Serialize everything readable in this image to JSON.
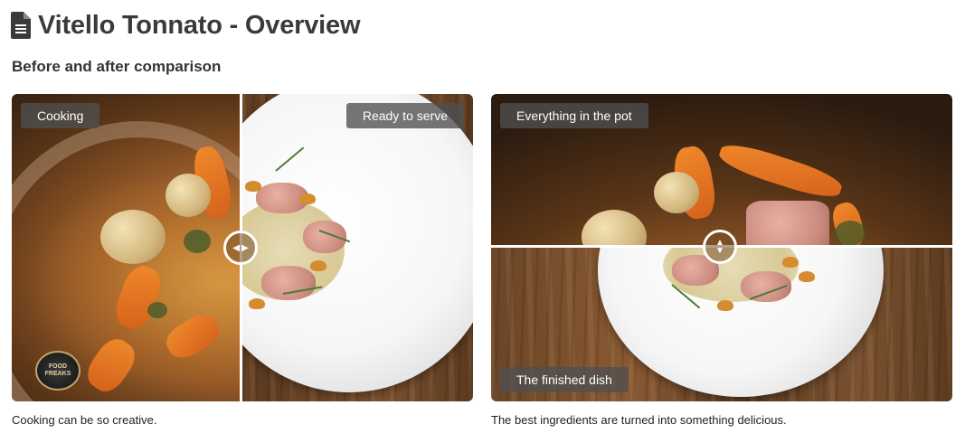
{
  "page": {
    "title": "Vitello Tonnato - Overview",
    "subtitle": "Before and after comparison",
    "title_icon": "document-icon"
  },
  "comparisons": [
    {
      "orientation": "vertical-split",
      "before_label": "Cooking",
      "after_label": "Ready to serve",
      "caption": "Cooking can be so creative.",
      "slider_position_percent": 49,
      "logo_text": "FOOD FREAKS"
    },
    {
      "orientation": "horizontal-split",
      "before_label": "Everything in the pot",
      "after_label": "The finished dish",
      "caption": "The best ingredients are turned into something delicious.",
      "slider_position_percent": 49
    }
  ],
  "colors": {
    "label_bg": "#505050",
    "divider": "#ffffff",
    "title_text": "#3a3a3a"
  }
}
